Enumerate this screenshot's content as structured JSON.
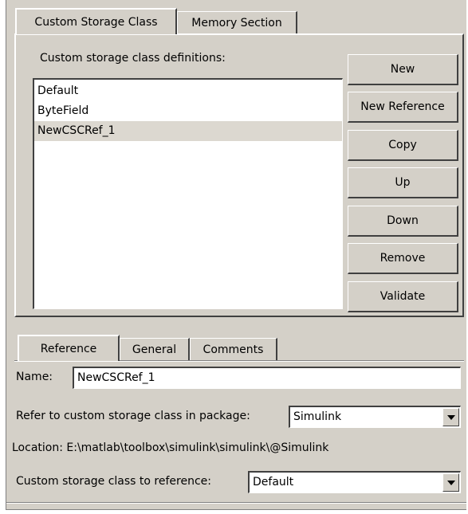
{
  "top_tabs": [
    "Custom Storage Class",
    "Memory Section"
  ],
  "definitions_label": "Custom storage class definitions:",
  "definitions": [
    {
      "name": "Default",
      "selected": false
    },
    {
      "name": "ByteField",
      "selected": false
    },
    {
      "name": "NewCSCRef_1",
      "selected": true
    }
  ],
  "buttons": {
    "new": "New",
    "new_reference": "New Reference",
    "copy": "Copy",
    "up": "Up",
    "down": "Down",
    "remove": "Remove",
    "validate": "Validate"
  },
  "bottom_tabs": [
    "Reference",
    "General",
    "Comments"
  ],
  "name_label": "Name:",
  "name_value": "NewCSCRef_1",
  "package_label": "Refer to custom storage class in package:",
  "package_value": "Simulink",
  "location_text": "Location: E:\\matlab\\toolbox\\simulink\\simulink\\@Simulink",
  "reference_label": "Custom storage class to reference:",
  "reference_value": "Default",
  "colors": {
    "dialog_bg": "#d4d0c8",
    "selection_bg": "#dcd8d0"
  }
}
